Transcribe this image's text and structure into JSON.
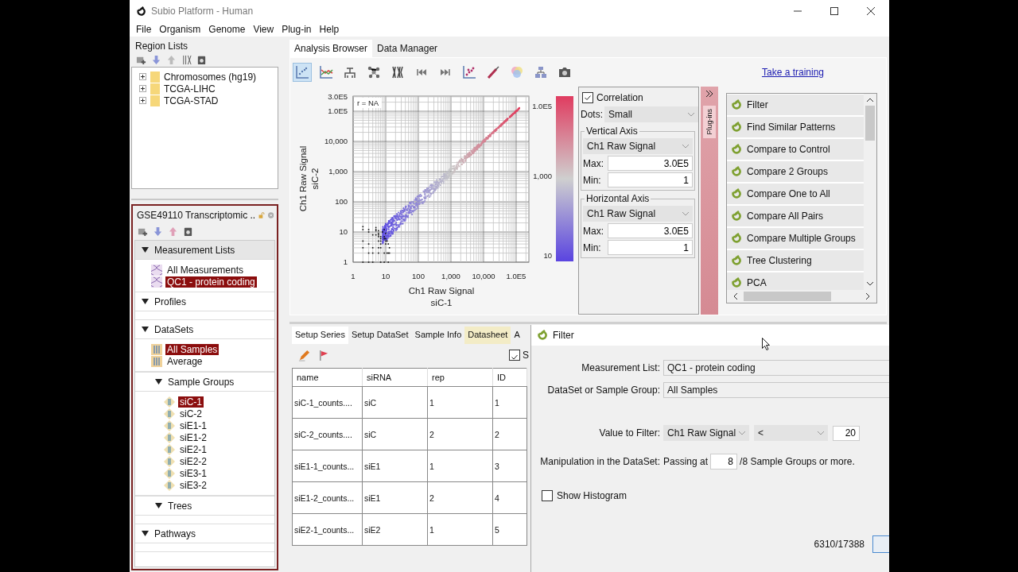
{
  "window": {
    "title": "Subio Platform - Human"
  },
  "menu": [
    "File",
    "Organism",
    "Genome",
    "View",
    "Plug-in",
    "Help"
  ],
  "region_lists": {
    "title": "Region Lists",
    "items": [
      {
        "label": "Chromosomes (hg19)",
        "expanded": false
      },
      {
        "label": "TCGA-LIHC",
        "expanded": false
      },
      {
        "label": "TCGA-STAD",
        "expanded": false
      }
    ]
  },
  "project": {
    "title": "GSE49110 Transcriptomic ..",
    "locked": false,
    "sections": [
      {
        "title": "Measurement Lists",
        "kind": "measurements",
        "expanded": true,
        "items": [
          {
            "label": "All Measurements",
            "selected": false
          },
          {
            "label": "QC1 - protein coding",
            "selected": true
          }
        ]
      },
      {
        "title": "Profiles",
        "expanded": true
      },
      {
        "title": "DataSets",
        "kind": "datasets",
        "expanded": true,
        "items": [
          {
            "label": "All Samples",
            "selected": true
          },
          {
            "label": "Average",
            "selected": false
          }
        ],
        "children": [
          {
            "title": "Sample Groups",
            "kind": "groups",
            "expanded": true,
            "items": [
              {
                "label": "siC-1",
                "selected": true
              },
              {
                "label": "siC-2",
                "selected": false
              },
              {
                "label": "siE1-1",
                "selected": false
              },
              {
                "label": "siE1-2",
                "selected": false
              },
              {
                "label": "siE2-1",
                "selected": false
              },
              {
                "label": "siE2-2",
                "selected": false
              },
              {
                "label": "siE3-1",
                "selected": false
              },
              {
                "label": "siE3-2",
                "selected": false
              }
            ]
          },
          {
            "title": "Trees",
            "expanded": true
          }
        ]
      },
      {
        "title": "Pathways",
        "expanded": true
      }
    ]
  },
  "analysis_tabs": [
    {
      "label": "Analysis Browser",
      "selected": true
    },
    {
      "label": "Data Manager",
      "selected": false
    }
  ],
  "toolbar": [
    {
      "kind": "scatter",
      "selected": true
    },
    {
      "kind": "lines",
      "selected": false
    },
    {
      "kind": "hierarchy",
      "selected": false
    },
    {
      "kind": "network",
      "selected": false
    },
    {
      "kind": "chromosomes",
      "selected": false
    },
    {
      "kind": "first",
      "selected": false
    },
    {
      "kind": "last",
      "selected": false
    },
    {
      "kind": "dots",
      "selected": false
    },
    {
      "kind": "brush",
      "selected": false
    },
    {
      "kind": "venn",
      "selected": false
    },
    {
      "kind": "pathway",
      "selected": false
    },
    {
      "kind": "camera",
      "selected": false
    }
  ],
  "training_link": "Take a training",
  "scatter": {
    "corner_label": "r = NA",
    "y_ticks": [
      "3.0E5",
      "1.0E5",
      "10,000",
      "1,000",
      "100",
      "10",
      "1"
    ],
    "x_ticks": [
      "1",
      "10",
      "100",
      "1,000",
      "10,000",
      "1.0E5"
    ],
    "x_title": "Ch1 Raw Signal",
    "x_subtitle": "siC-1",
    "y_title": "Ch1 Raw Signal",
    "y_subtitle": "siC-2",
    "scale_labels": [
      "1.0E5",
      "1,000",
      "10"
    ]
  },
  "settings": {
    "correlation": {
      "label": "Correlation",
      "checked": true
    },
    "dots": {
      "label": "Dots:",
      "value": "Small"
    },
    "axes": [
      {
        "title": "Vertical Axis",
        "value": "Ch1 Raw Signal",
        "max_label": "Max:",
        "max": "3.0E5",
        "min_label": "Min:",
        "min": "1"
      },
      {
        "title": "Horizontal Axis",
        "value": "Ch1 Raw Signal",
        "max_label": "Max:",
        "max": "3.0E5",
        "min_label": "Min:",
        "min": "1"
      }
    ]
  },
  "plugins": {
    "tab_label": "Plug-ins",
    "items": [
      "Filter",
      "Find Similar Patterns",
      "Compare to Control",
      "Compare 2 Groups",
      "Compare One to All",
      "Compare All Pairs",
      "Compare Multiple Groups",
      "Tree Clustering",
      "PCA"
    ]
  },
  "bottom_tabs": [
    {
      "label": "Setup Series",
      "selected": true,
      "highlighted": false
    },
    {
      "label": "Setup DataSet",
      "selected": false,
      "highlighted": false
    },
    {
      "label": "Sample Info",
      "selected": false,
      "highlighted": false
    },
    {
      "label": "Datasheet",
      "selected": false,
      "highlighted": true
    },
    {
      "label": "A",
      "selected": false,
      "highlighted": false
    }
  ],
  "series_option": {
    "label": "S",
    "checked": true
  },
  "series_table": {
    "columns": [
      "name",
      "siRNA",
      "rep",
      "ID"
    ],
    "rows": [
      [
        "siC-1_counts....",
        "siC",
        "1",
        "1"
      ],
      [
        "siC-2_counts....",
        "siC",
        "2",
        "2"
      ],
      [
        "siE1-1_counts...",
        "siE1",
        "1",
        "3"
      ],
      [
        "siE1-2_counts...",
        "siE1",
        "2",
        "4"
      ],
      [
        "siE2-1_counts...",
        "siE2",
        "1",
        "5"
      ]
    ]
  },
  "filter_dialog": {
    "title": "Filter",
    "measurement_list": {
      "label": "Measurement List:",
      "value": "QC1 - protein coding"
    },
    "dataset": {
      "label": "DataSet or Sample Group:",
      "value": "All Samples"
    },
    "value_filter": {
      "label": "Value to Filter:",
      "column": "Ch1 Raw Signal",
      "operator": "<",
      "threshold": "20"
    },
    "manipulation": {
      "label": "Manipulation in the DataSet:",
      "prefix": "Passing at",
      "count": "8",
      "suffix": "/8  Sample Groups or more."
    },
    "show_histogram": {
      "label": "Show Histogram",
      "checked": false
    },
    "result_count": "6310/17388"
  }
}
